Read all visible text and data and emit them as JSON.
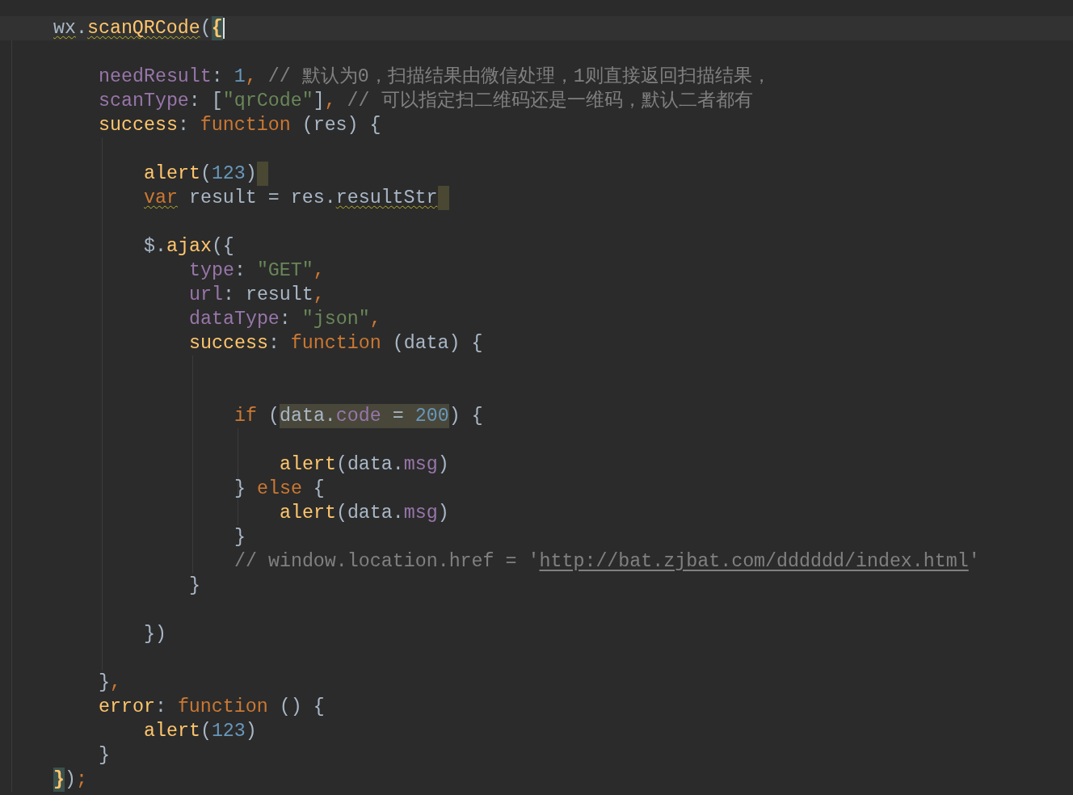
{
  "editor": {
    "lines": [
      {
        "current": true,
        "tokens": [
          {
            "text": "wx",
            "kind": "plain",
            "squiggly": true
          },
          {
            "text": ".",
            "kind": "plain"
          },
          {
            "text": "scanQRCode",
            "kind": "func",
            "squiggly": true
          },
          {
            "text": "(",
            "kind": "plain"
          },
          {
            "text": "{",
            "kind": "func",
            "bracket_match": true,
            "caret": true
          }
        ],
        "children": [
          {
            "current": false
          },
          {
            "current": false,
            "tokens": [
              {
                "text": "needResult",
                "kind": "prop"
              },
              {
                "text": ": ",
                "kind": "plain"
              },
              {
                "text": "1",
                "kind": "number"
              },
              {
                "text": ", ",
                "kind": "keyword"
              },
              {
                "text": "// 默认为0，扫描结果由微信处理，1则直接返回扫描结果，",
                "kind": "comment"
              }
            ]
          },
          {
            "current": false,
            "tokens": [
              {
                "text": "scanType",
                "kind": "prop"
              },
              {
                "text": ": [",
                "kind": "plain"
              },
              {
                "text": "\"qrCode\"",
                "kind": "string"
              },
              {
                "text": "]",
                "kind": "plain"
              },
              {
                "text": ", ",
                "kind": "keyword"
              },
              {
                "text": "// 可以指定扫二维码还是一维码，默认二者都有",
                "kind": "comment"
              }
            ]
          },
          {
            "current": false,
            "tokens": [
              {
                "text": "success",
                "kind": "func"
              },
              {
                "text": ": ",
                "kind": "plain"
              },
              {
                "text": "function",
                "kind": "keyword"
              },
              {
                "text": " (res) {",
                "kind": "plain"
              }
            ],
            "children": [
              {
                "current": false
              },
              {
                "current": false,
                "trailing_space": true,
                "tokens": [
                  {
                    "text": "alert",
                    "kind": "func"
                  },
                  {
                    "text": "(",
                    "kind": "plain"
                  },
                  {
                    "text": "123",
                    "kind": "number"
                  },
                  {
                    "text": ")",
                    "kind": "plain"
                  }
                ]
              },
              {
                "current": false,
                "trailing_space": true,
                "tokens": [
                  {
                    "text": "var",
                    "kind": "keyword",
                    "squiggly": true
                  },
                  {
                    "text": " result = res.",
                    "kind": "plain"
                  },
                  {
                    "text": "resultStr",
                    "kind": "plain",
                    "squiggly": true
                  }
                ]
              },
              {
                "current": false
              },
              {
                "current": false,
                "tokens": [
                  {
                    "text": "$.",
                    "kind": "plain"
                  },
                  {
                    "text": "ajax",
                    "kind": "func"
                  },
                  {
                    "text": "({",
                    "kind": "plain"
                  }
                ],
                "children": [
                  {
                    "current": false,
                    "tokens": [
                      {
                        "text": "type",
                        "kind": "prop"
                      },
                      {
                        "text": ": ",
                        "kind": "plain"
                      },
                      {
                        "text": "\"GET\"",
                        "kind": "string"
                      },
                      {
                        "text": ",",
                        "kind": "keyword"
                      }
                    ]
                  },
                  {
                    "current": false,
                    "tokens": [
                      {
                        "text": "url",
                        "kind": "prop"
                      },
                      {
                        "text": ": result",
                        "kind": "plain"
                      },
                      {
                        "text": ",",
                        "kind": "keyword"
                      }
                    ]
                  },
                  {
                    "current": false,
                    "tokens": [
                      {
                        "text": "dataType",
                        "kind": "prop"
                      },
                      {
                        "text": ": ",
                        "kind": "plain"
                      },
                      {
                        "text": "\"json\"",
                        "kind": "string"
                      },
                      {
                        "text": ",",
                        "kind": "keyword"
                      }
                    ]
                  },
                  {
                    "current": false,
                    "tokens": [
                      {
                        "text": "success",
                        "kind": "func"
                      },
                      {
                        "text": ": ",
                        "kind": "plain"
                      },
                      {
                        "text": "function",
                        "kind": "keyword"
                      },
                      {
                        "text": " (data) {",
                        "kind": "plain"
                      }
                    ],
                    "children": [
                      {
                        "current": false
                      },
                      {
                        "current": false
                      },
                      {
                        "current": false,
                        "tokens": [
                          {
                            "text": "if",
                            "kind": "keyword"
                          },
                          {
                            "text": " (",
                            "kind": "plain"
                          },
                          {
                            "text": "data.",
                            "kind": "plain",
                            "highlighted": true
                          },
                          {
                            "text": "code",
                            "kind": "prop",
                            "highlighted": true
                          },
                          {
                            "text": " = ",
                            "kind": "plain",
                            "highlighted": true
                          },
                          {
                            "text": "200",
                            "kind": "number",
                            "highlighted": true
                          },
                          {
                            "text": ") {",
                            "kind": "plain"
                          }
                        ],
                        "children": [
                          {
                            "current": false
                          },
                          {
                            "current": false,
                            "tokens": [
                              {
                                "text": "alert",
                                "kind": "func"
                              },
                              {
                                "text": "(data.",
                                "kind": "plain"
                              },
                              {
                                "text": "msg",
                                "kind": "prop"
                              },
                              {
                                "text": ")",
                                "kind": "plain"
                              }
                            ]
                          }
                        ]
                      },
                      {
                        "current": false,
                        "tokens": [
                          {
                            "text": "} ",
                            "kind": "plain"
                          },
                          {
                            "text": "else",
                            "kind": "keyword"
                          },
                          {
                            "text": " {",
                            "kind": "plain"
                          }
                        ],
                        "children": [
                          {
                            "current": false,
                            "tokens": [
                              {
                                "text": "alert",
                                "kind": "func"
                              },
                              {
                                "text": "(data.",
                                "kind": "plain"
                              },
                              {
                                "text": "msg",
                                "kind": "prop"
                              },
                              {
                                "text": ")",
                                "kind": "plain"
                              }
                            ]
                          }
                        ]
                      },
                      {
                        "current": false,
                        "tokens": [
                          {
                            "text": "}",
                            "kind": "plain"
                          }
                        ]
                      },
                      {
                        "current": false,
                        "tokens": [
                          {
                            "text": "// window.location.href = '",
                            "kind": "comment"
                          },
                          {
                            "text": "http://bat.zjbat.com/dddddd/index.html",
                            "kind": "comment",
                            "link": true
                          },
                          {
                            "text": "'",
                            "kind": "comment"
                          }
                        ]
                      }
                    ]
                  },
                  {
                    "current": false,
                    "tokens": [
                      {
                        "text": "}",
                        "kind": "plain"
                      }
                    ]
                  }
                ]
              },
              {
                "current": false
              },
              {
                "current": false,
                "tokens": [
                  {
                    "text": "})",
                    "kind": "plain"
                  }
                ]
              },
              {
                "current": false
              }
            ]
          },
          {
            "current": false,
            "tokens": [
              {
                "text": "}",
                "kind": "plain"
              },
              {
                "text": ",",
                "kind": "keyword"
              }
            ]
          },
          {
            "current": false,
            "tokens": [
              {
                "text": "error",
                "kind": "func"
              },
              {
                "text": ": ",
                "kind": "plain"
              },
              {
                "text": "function",
                "kind": "keyword"
              },
              {
                "text": " () {",
                "kind": "plain"
              }
            ],
            "children": [
              {
                "current": false,
                "tokens": [
                  {
                    "text": "alert",
                    "kind": "func"
                  },
                  {
                    "text": "(",
                    "kind": "plain"
                  },
                  {
                    "text": "123",
                    "kind": "number"
                  },
                  {
                    "text": ")",
                    "kind": "plain"
                  }
                ]
              }
            ]
          },
          {
            "current": false,
            "tokens": [
              {
                "text": "}",
                "kind": "plain"
              }
            ]
          }
        ]
      },
      {
        "current": false,
        "tokens": [
          {
            "text": "}",
            "kind": "func",
            "bracket_match": true
          },
          {
            "text": ")",
            "kind": "plain"
          },
          {
            "text": ";",
            "kind": "keyword"
          }
        ]
      }
    ]
  }
}
